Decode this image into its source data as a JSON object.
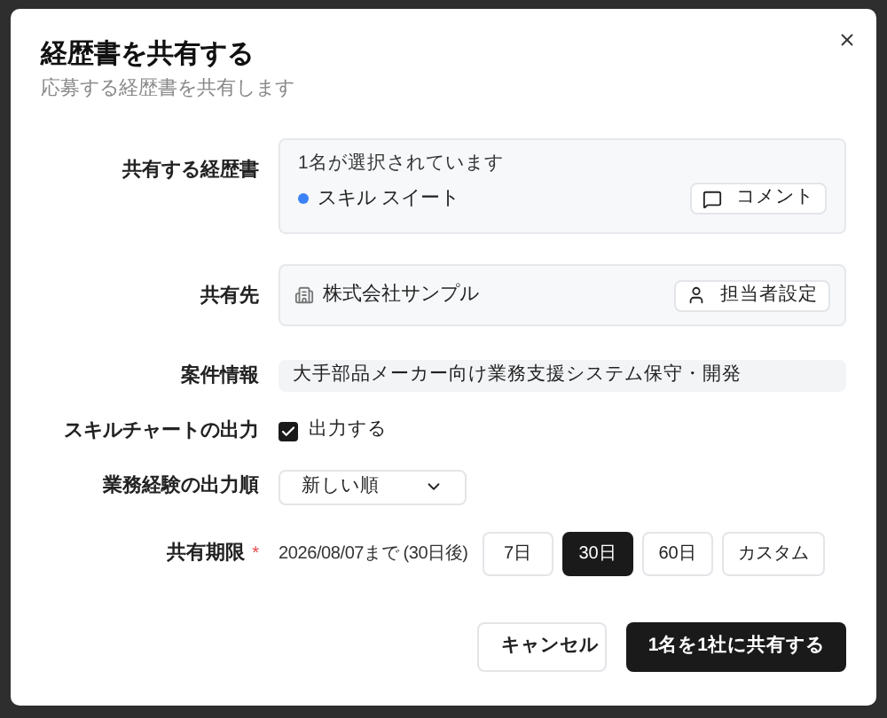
{
  "dialog": {
    "title": "経歴書を共有する",
    "subtitle": "応募する経歴書を共有します"
  },
  "resume": {
    "label": "共有する経歴書",
    "count_text": "1名が選択されています",
    "items": [
      {
        "name": "スキル スイート",
        "color": "#3b82f6",
        "comment_button": "コメント"
      }
    ]
  },
  "recipient": {
    "label": "共有先",
    "company": "株式会社サンプル",
    "assignee_button": "担当者設定"
  },
  "project": {
    "label": "案件情報",
    "value": "大手部品メーカー向け業務支援システム保守・開発"
  },
  "skill_chart": {
    "label": "スキルチャートの出力",
    "option": "出力する",
    "checked": true
  },
  "order": {
    "label": "業務経験の出力順",
    "value": "新しい順"
  },
  "period": {
    "label": "共有期限",
    "required_mark": "*",
    "summary": "2026/08/07まで (30日後)",
    "options": [
      {
        "label": "7日",
        "selected": false
      },
      {
        "label": "30日",
        "selected": true
      },
      {
        "label": "60日",
        "selected": false
      },
      {
        "label": "カスタム",
        "selected": false
      }
    ]
  },
  "buttons": {
    "cancel": "キャンセル",
    "submit": "1名を1社に共有する"
  }
}
